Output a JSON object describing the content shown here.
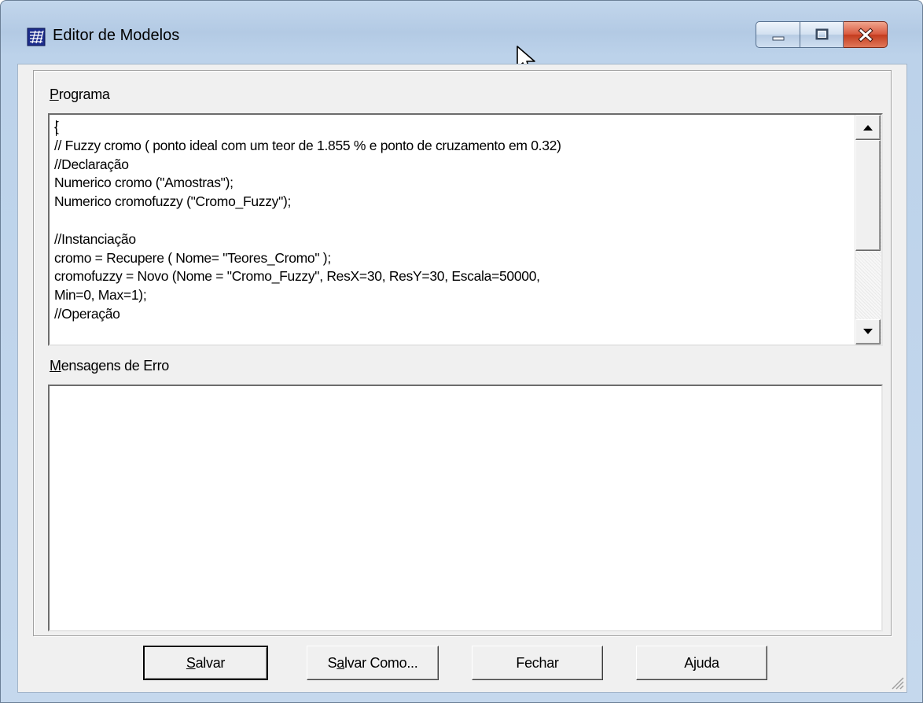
{
  "window": {
    "title": "Editor de Modelos"
  },
  "program": {
    "label_accesskey": "P",
    "label_rest": "rograma",
    "lines": [
      "{",
      "// Fuzzy cromo ( ponto ideal com um teor de 1.855 % e ponto de cruzamento em 0.32)",
      "//Declaração",
      "Numerico cromo (\"Amostras\");",
      "Numerico cromofuzzy (\"Cromo_Fuzzy\");",
      "",
      "//Instanciação",
      "cromo = Recupere ( Nome= \"Teores_Cromo\" );",
      "cromofuzzy = Novo (Nome = \"Cromo_Fuzzy\", ResX=30, ResY=30, Escala=50000,",
      "Min=0, Max=1);",
      "//Operação"
    ]
  },
  "errors": {
    "label_accesskey": "M",
    "label_rest": "ensagens de Erro",
    "content": ""
  },
  "buttons": {
    "save_pre": "",
    "save_key": "S",
    "save_post": "alvar",
    "save_as_pre": "S",
    "save_as_key": "a",
    "save_as_post": "lvar Como...",
    "close_label": "Fechar",
    "help_pre": "A",
    "help_key": "j",
    "help_post": "uda"
  },
  "icons": {
    "app": "grid-map-icon",
    "minimize": "minimize-icon",
    "maximize": "maximize-icon",
    "close": "close-icon",
    "scroll_up": "arrow-up-icon",
    "scroll_down": "arrow-down-icon",
    "resize": "resize-grip-icon",
    "cursor": "mouse-pointer-icon"
  },
  "colors": {
    "title_bar": "#bcd2ea",
    "close_button": "#c9462a",
    "dialog_face": "#f0f0f0"
  }
}
